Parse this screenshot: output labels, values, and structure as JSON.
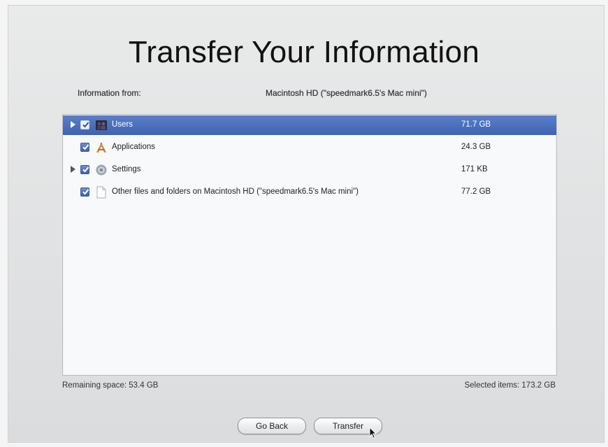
{
  "title": "Transfer Your Information",
  "source": {
    "label": "Information from:",
    "value": "Macintosh HD (\"speedmark6.5's Mac mini\")"
  },
  "items": [
    {
      "label": "Users",
      "size": "71.7 GB",
      "checked": true,
      "expandable": true,
      "selected": true,
      "icon": "users-icon"
    },
    {
      "label": "Applications",
      "size": "24.3 GB",
      "checked": true,
      "expandable": false,
      "selected": false,
      "icon": "applications-icon"
    },
    {
      "label": "Settings",
      "size": "171 KB",
      "checked": true,
      "expandable": true,
      "selected": false,
      "icon": "settings-icon"
    },
    {
      "label": "Other files and folders on Macintosh HD (\"speedmark6.5's Mac mini\")",
      "size": "77.2 GB",
      "checked": true,
      "expandable": false,
      "selected": false,
      "icon": "document-icon"
    }
  ],
  "footer": {
    "remaining": "Remaining space: 53.4 GB",
    "selected": "Selected items: 173.2 GB"
  },
  "buttons": {
    "back": "Go Back",
    "transfer": "Transfer"
  },
  "colors": {
    "selection": "#4a6fbe",
    "checkbox": "#4a6bb8"
  }
}
